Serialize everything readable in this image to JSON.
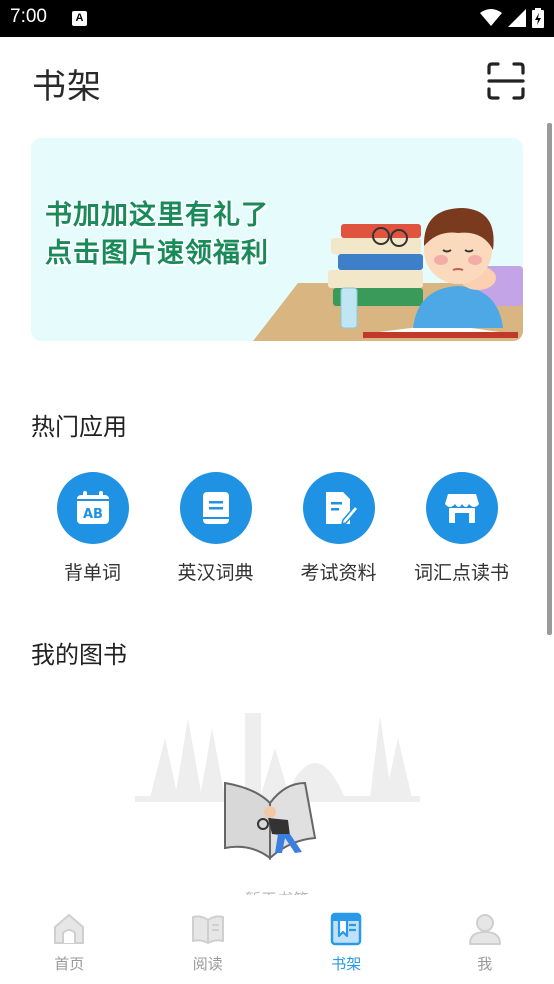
{
  "status_bar": {
    "time": "7:00",
    "a_badge": "A"
  },
  "header": {
    "title": "书架",
    "scan_icon": "scan-icon"
  },
  "banner": {
    "line1": "书加加这里有礼了",
    "line2": "点击图片速领福利"
  },
  "hot_apps": {
    "title": "热门应用",
    "items": [
      {
        "label": "背单词",
        "icon": "calendar-ab-icon"
      },
      {
        "label": "英汉词典",
        "icon": "book-icon"
      },
      {
        "label": "考试资料",
        "icon": "document-pen-icon"
      },
      {
        "label": "词汇点读书",
        "icon": "store-icon"
      }
    ]
  },
  "my_books": {
    "title": "我的图书",
    "empty_text": "暂无书籍"
  },
  "tab_bar": {
    "items": [
      {
        "label": "首页",
        "icon": "home-icon"
      },
      {
        "label": "阅读",
        "icon": "read-book-icon"
      },
      {
        "label": "书架",
        "icon": "bookshelf-icon"
      },
      {
        "label": "我",
        "icon": "user-icon"
      }
    ],
    "active": "书架",
    "active_color": "#2a9ae8",
    "inactive_color": "#999999"
  },
  "colors": {
    "accent": "#1f92e3",
    "banner_bg": "#e6fbfc",
    "banner_text": "#1a8a5a"
  }
}
